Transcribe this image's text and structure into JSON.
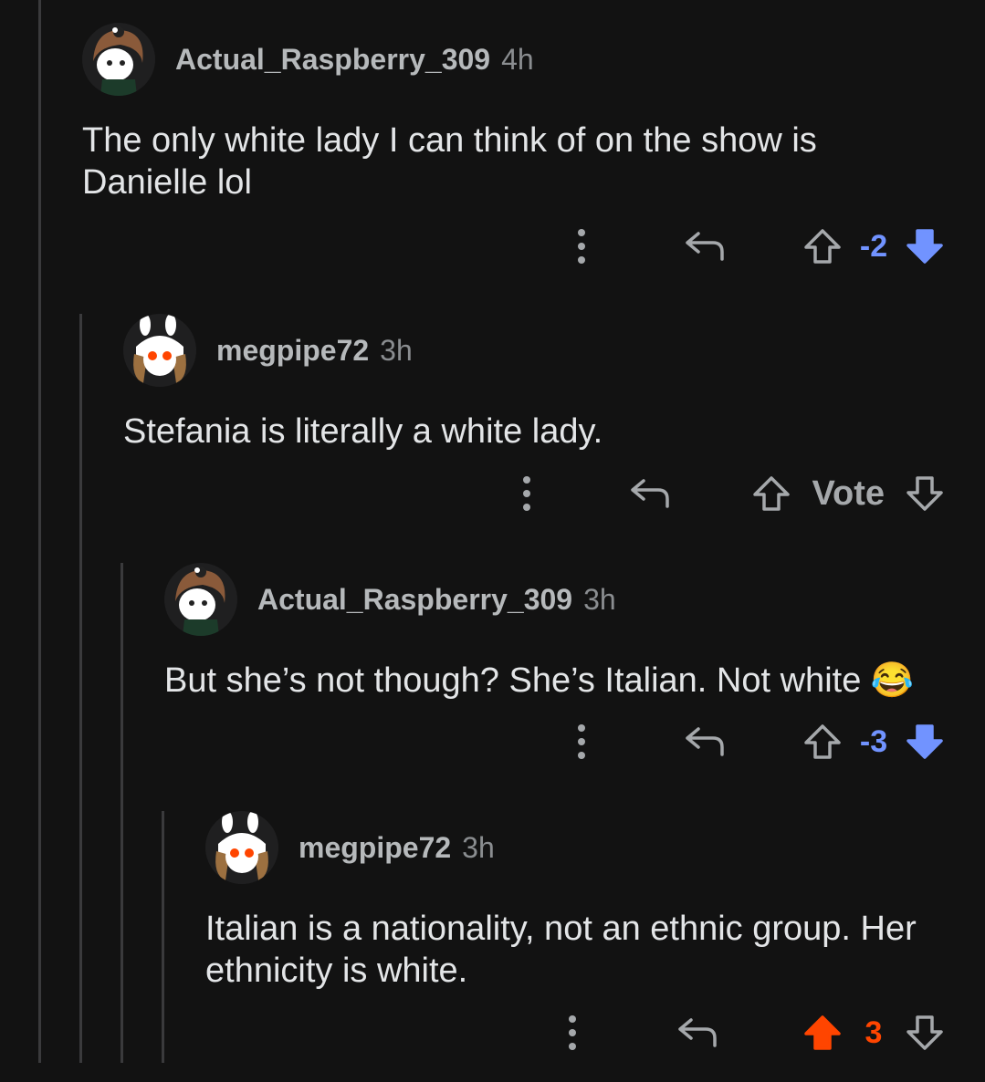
{
  "colors": {
    "background": "#121212",
    "thread_line": "#3a3a3c",
    "downvote_active": "#7193ff",
    "upvote_active": "#ff4500",
    "icon_gray": "#a5a8ab"
  },
  "comments": [
    {
      "username": "Actual_Raspberry_309",
      "time": "4h",
      "text": "The only white lady I can think of on the show is Danielle lol",
      "score": "-2",
      "vote_state": "downvoted",
      "avatar_icon": "squirrel-hood-avatar-icon"
    },
    {
      "username": "megpipe72",
      "time": "3h",
      "text": "Stefania is literally a white lady.",
      "score": "Vote",
      "vote_state": "none",
      "avatar_icon": "bunny-ears-avatar-icon"
    },
    {
      "username": "Actual_Raspberry_309",
      "time": "3h",
      "text": "But she’s not though? She’s Italian. Not white 😂",
      "score": "-3",
      "vote_state": "downvoted",
      "avatar_icon": "squirrel-hood-avatar-icon"
    },
    {
      "username": "megpipe72",
      "time": "3h",
      "text": "Italian is a nationality, not an ethnic group. Her ethnicity is white.",
      "score": "3",
      "vote_state": "upvoted",
      "avatar_icon": "bunny-ears-avatar-icon"
    }
  ]
}
